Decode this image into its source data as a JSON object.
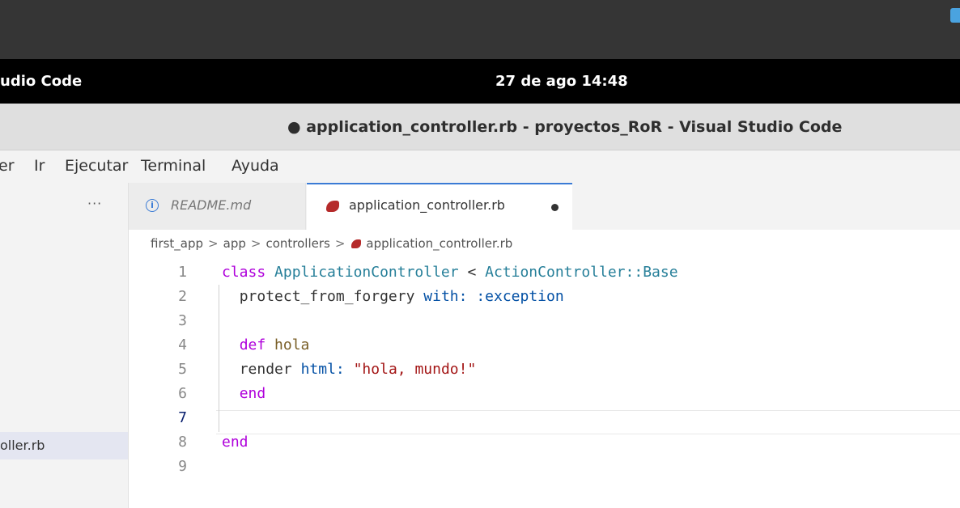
{
  "top_bar": {
    "app_name": "udio Code",
    "clock": "27 de ago  14:48"
  },
  "window": {
    "title": "● application_controller.rb - proyectos_RoR - Visual Studio Code"
  },
  "menu": {
    "items": [
      "er",
      "Ir",
      "Ejecutar",
      "Terminal",
      "Ayuda"
    ]
  },
  "sidebar": {
    "more_actions": "···",
    "file_label": "oller.rb"
  },
  "tabs": [
    {
      "label": "README.md",
      "icon": "info-icon"
    },
    {
      "label": "application_controller.rb",
      "icon": "ruby-icon",
      "dirty": true
    }
  ],
  "breadcrumb": [
    "first_app",
    "app",
    "controllers",
    "application_controller.rb"
  ],
  "editor": {
    "current_line": 7,
    "lines": [
      {
        "n": "1",
        "tokens": [
          [
            "kw",
            "class"
          ],
          [
            "op",
            " "
          ],
          [
            "cls",
            "ApplicationController"
          ],
          [
            "op",
            " < "
          ],
          [
            "cls",
            "ActionController::Base"
          ]
        ]
      },
      {
        "n": "2",
        "tokens": [
          [
            "op",
            "  "
          ],
          [
            "id",
            "protect_from_forgery"
          ],
          [
            "op",
            " "
          ],
          [
            "sym",
            "with:"
          ],
          [
            "op",
            " "
          ],
          [
            "sym",
            ":exception"
          ]
        ]
      },
      {
        "n": "3",
        "tokens": []
      },
      {
        "n": "4",
        "tokens": [
          [
            "op",
            "  "
          ],
          [
            "kw",
            "def"
          ],
          [
            "op",
            " "
          ],
          [
            "fn",
            "hola"
          ]
        ]
      },
      {
        "n": "5",
        "tokens": [
          [
            "op",
            "  "
          ],
          [
            "id",
            "render"
          ],
          [
            "op",
            " "
          ],
          [
            "sym",
            "html:"
          ],
          [
            "op",
            " "
          ],
          [
            "str",
            "\"hola, mundo!\""
          ]
        ]
      },
      {
        "n": "6",
        "tokens": [
          [
            "op",
            "  "
          ],
          [
            "kw",
            "end"
          ]
        ]
      },
      {
        "n": "7",
        "tokens": []
      },
      {
        "n": "8",
        "tokens": [
          [
            "kw",
            "end"
          ]
        ]
      },
      {
        "n": "9",
        "tokens": []
      }
    ]
  },
  "colors": {
    "keyword": "#af00db",
    "class": "#267f99",
    "symbol": "#0451a5",
    "string": "#a31515",
    "function": "#795e26",
    "tab_accent": "#3a7bd5"
  }
}
